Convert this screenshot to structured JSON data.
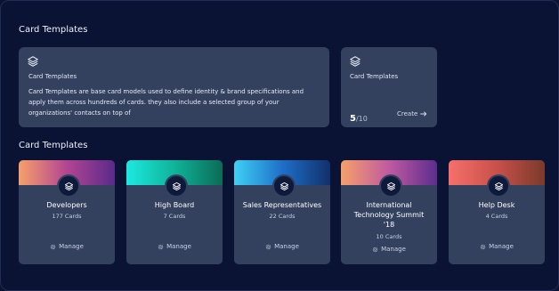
{
  "header": {
    "title": "Card Templates"
  },
  "info_panel": {
    "title": "Card Templates",
    "description": "Card Templates are base card models used to define identity & brand specifications and apply them across hundreds of cards. they also include a selected group of your organizations' contacts on top of"
  },
  "usage_panel": {
    "title": "Card Templates",
    "used": "5",
    "total": "/10",
    "create_label": "Create"
  },
  "templates_section": {
    "title": "Card Templates"
  },
  "cards": [
    {
      "name": "Developers",
      "count": "177 Cards",
      "manage": "Manage",
      "gradient": [
        "#f7a06a",
        "#b24592",
        "#5a2a8a"
      ]
    },
    {
      "name": "High Board",
      "count": "7 Cards",
      "manage": "Manage",
      "gradient": [
        "#1de9e0",
        "#0fb39a",
        "#0b6b55"
      ]
    },
    {
      "name": "Sales Representatives",
      "count": "22 Cards",
      "manage": "Manage",
      "gradient": [
        "#3fd0f5",
        "#1e6fc8",
        "#12306b"
      ]
    },
    {
      "name": "International Technology Summit '18",
      "count": "10 Cards",
      "manage": "Manage",
      "gradient": [
        "#f6a06a",
        "#c05aa0",
        "#5d2d8e"
      ]
    },
    {
      "name": "Help Desk",
      "count": "4 Cards",
      "manage": "Manage",
      "gradient": [
        "#f7706a",
        "#c9504b",
        "#7a3a2a"
      ]
    }
  ],
  "colors": {
    "background": "#0b1334",
    "panel": "#33415f",
    "badge": "#0e1a3c"
  },
  "icons": {
    "template": "stack-layers-icon",
    "manage": "gear-icon",
    "create": "arrow-right-icon"
  }
}
